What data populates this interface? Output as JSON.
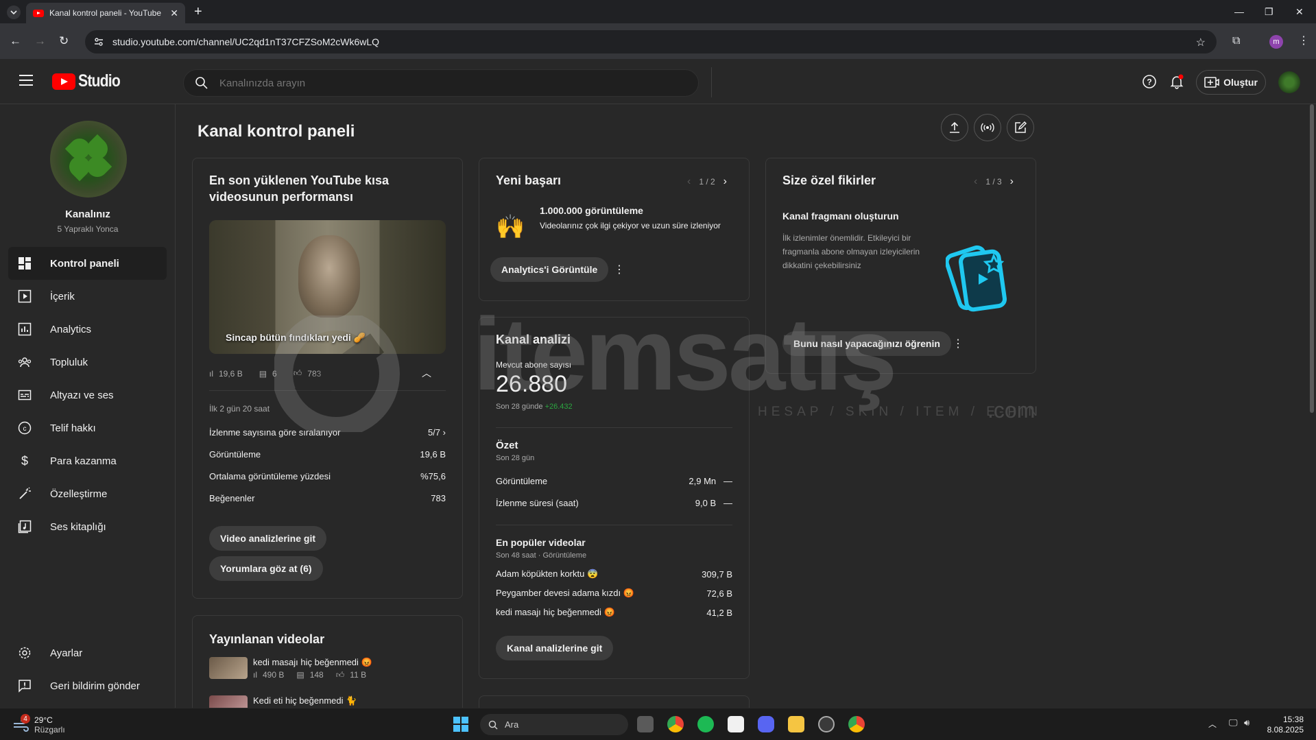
{
  "browser": {
    "tab_title": "Kanal kontrol paneli - YouTube",
    "url": "studio.youtube.com/channel/UC2qd1nT37CFZSoM2cWk6wLQ",
    "profile_initial": "m"
  },
  "header": {
    "logo_text": "Studio",
    "search_placeholder": "Kanalınızda arayın",
    "create_label": "Oluştur"
  },
  "sidebar": {
    "channel_name": "Kanalınız",
    "channel_handle": "5 Yapraklı Yonca",
    "items": [
      {
        "label": "Kontrol paneli",
        "icon": "dashboard-icon"
      },
      {
        "label": "İçerik",
        "icon": "content-icon"
      },
      {
        "label": "Analytics",
        "icon": "analytics-icon"
      },
      {
        "label": "Topluluk",
        "icon": "community-icon"
      },
      {
        "label": "Altyazı ve ses",
        "icon": "subtitles-icon"
      },
      {
        "label": "Telif hakkı",
        "icon": "copyright-icon"
      },
      {
        "label": "Para kazanma",
        "icon": "monetization-icon"
      },
      {
        "label": "Özelleştirme",
        "icon": "customization-icon"
      },
      {
        "label": "Ses kitaplığı",
        "icon": "audio-library-icon"
      }
    ],
    "bottom": [
      {
        "label": "Ayarlar",
        "icon": "gear-icon"
      },
      {
        "label": "Geri bildirim gönder",
        "icon": "feedback-icon"
      }
    ]
  },
  "main": {
    "title": "Kanal kontrol paneli",
    "shorts_card": {
      "title": "En son yüklenen YouTube kısa videosunun performansı",
      "video_title": "Sincap bütün fındıkları yedi 🥜",
      "views": "19,6 B",
      "comments": "6",
      "likes": "783",
      "period": "İlk 2 gün 20 saat",
      "rows": [
        {
          "label": "İzlenme sayısına göre sıralanıyor",
          "value": "5/7"
        },
        {
          "label": "Görüntüleme",
          "value": "19,6 B"
        },
        {
          "label": "Ortalama görüntüleme yüzdesi",
          "value": "%75,6"
        },
        {
          "label": "Beğenenler",
          "value": "783"
        }
      ],
      "btn_analytics": "Video analizlerine git",
      "btn_comments": "Yorumlara göz at (6)"
    },
    "published_card": {
      "title": "Yayınlanan videolar",
      "videos": [
        {
          "title": "kedi masajı hiç beğenmedi 😡",
          "views": "490 B",
          "comments": "148",
          "likes": "11 B"
        },
        {
          "title": "Kedi eti hiç beğenmedi 🐈"
        }
      ]
    },
    "achievement_card": {
      "title": "Yeni başarı",
      "pager": "1 / 2",
      "headline": "1.000.000 görüntüleme",
      "desc": "Videolarınız çok ilgi çekiyor ve uzun süre izleniyor",
      "button": "Analytics'i Görüntüle"
    },
    "analytics_card": {
      "title": "Kanal analizi",
      "subs_label": "Mevcut abone sayısı",
      "subs_value": "26.880",
      "subs_period": "Son 28 günde",
      "subs_delta": "+26.432",
      "summary_title": "Özet",
      "summary_period": "Son 28 gün",
      "summary_rows": [
        {
          "label": "Görüntüleme",
          "value": "2,9 Mn",
          "trend": "—"
        },
        {
          "label": "İzlenme süresi (saat)",
          "value": "9,0 B",
          "trend": "—"
        }
      ],
      "top_title": "En popüler videolar",
      "top_period": "Son 48 saat · Görüntüleme",
      "top_videos": [
        {
          "label": "Adam köpükten korktu 😨",
          "value": "309,7 B"
        },
        {
          "label": "Peygamber devesi adama kızdı 😡",
          "value": "72,6 B"
        },
        {
          "label": "kedi masajı hiç beğenmedi 😡",
          "value": "41,2 B"
        }
      ],
      "button": "Kanal analizlerine git"
    },
    "ideas_card": {
      "title": "Size özel fikirler",
      "pager": "1 / 3",
      "headline": "Kanal fragmanı oluşturun",
      "desc": "İlk izlenimler önemlidir. Etkileyici bir fragmanla abone olmayan izleyicilerin dikkatini çekebilirsiniz",
      "button": "Bunu nasıl yapacağınızı öğrenin"
    }
  },
  "watermark": {
    "brand": "itemsatış",
    "tagline": "HESAP / SKIN / ITEM / E-PIN",
    "suffix": ".com"
  },
  "taskbar": {
    "temp": "29°C",
    "weather": "Rüzgarlı",
    "weather_badge": "4",
    "search": "Ara",
    "time": "15:38",
    "date": "8.08.2025"
  },
  "colors": {
    "accent_red": "#ff0000",
    "delta_green": "#2ba640",
    "bg": "#282828"
  }
}
